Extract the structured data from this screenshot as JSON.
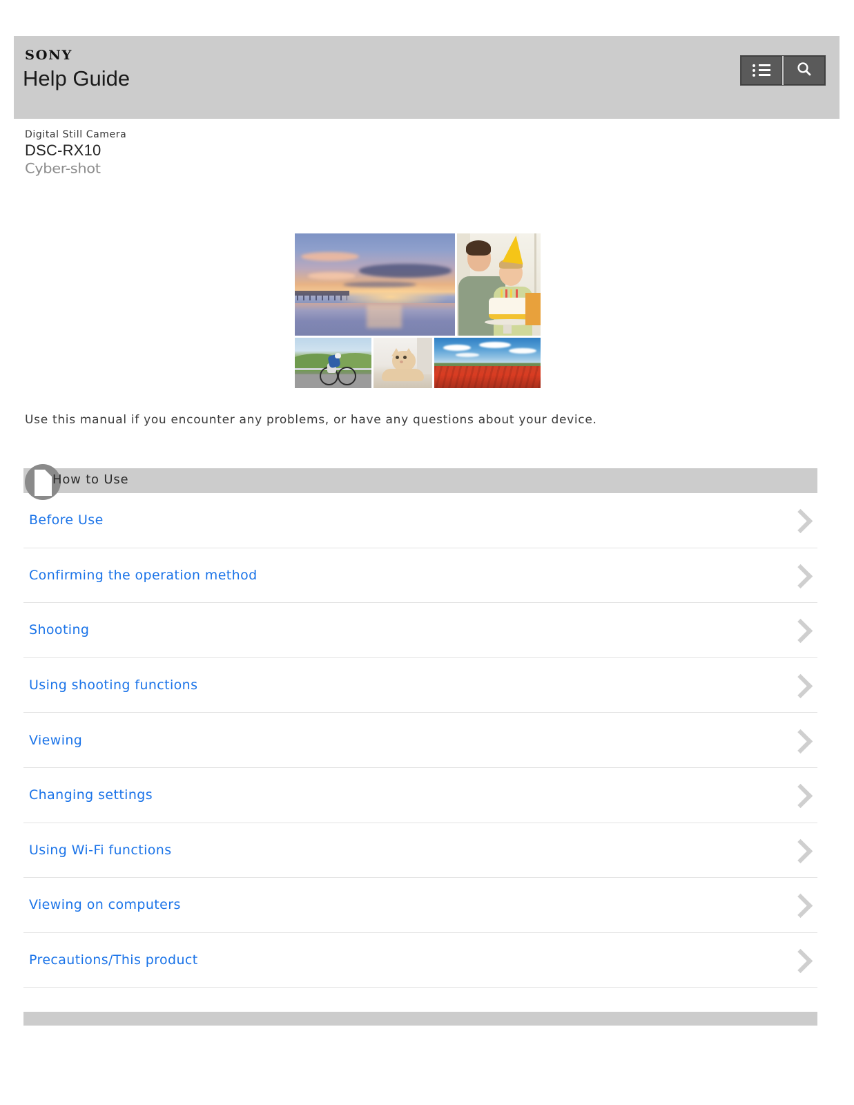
{
  "header": {
    "brand": "SONY",
    "title": "Help Guide",
    "buttons": [
      {
        "name": "menu-button",
        "icon": "list-icon",
        "label": ""
      },
      {
        "name": "search-button",
        "icon": "search-icon",
        "label": ""
      }
    ]
  },
  "product": {
    "kind": "Digital Still Camera",
    "model": "DSC-RX10",
    "series_logo": "Cyber-shot"
  },
  "hero": {
    "images": [
      {
        "name": "sunset-beach-photo",
        "alt": "Sunset over beach pier"
      },
      {
        "name": "birthday-party-photo",
        "alt": "Father and child with birthday cake"
      },
      {
        "name": "cyclist-photo",
        "alt": "Cyclist riding on coastal road"
      },
      {
        "name": "cat-photo",
        "alt": "Ginger cat peeking around a corner"
      },
      {
        "name": "poppy-field-photo",
        "alt": "Red poppy field under blue sky"
      }
    ]
  },
  "intro": {
    "text": "Use this manual if you encounter any problems, or have any questions about your device."
  },
  "section": {
    "title": "How to Use",
    "icon": "book-page-icon"
  },
  "links": [
    {
      "label": "Before Use"
    },
    {
      "label": "Confirming the operation method"
    },
    {
      "label": "Shooting"
    },
    {
      "label": "Using shooting functions"
    },
    {
      "label": "Viewing"
    },
    {
      "label": "Changing settings"
    },
    {
      "label": "Using Wi-Fi functions"
    },
    {
      "label": "Viewing on computers"
    },
    {
      "label": "Precautions/This product"
    }
  ],
  "colors": {
    "header_band": "#cccccc",
    "link_blue": "#1a73e8",
    "button_bg": "#5a5a5a",
    "chevron": "#cfcfcf",
    "divider": "#e2e2e2",
    "section_icon": "#8a8a8a"
  }
}
